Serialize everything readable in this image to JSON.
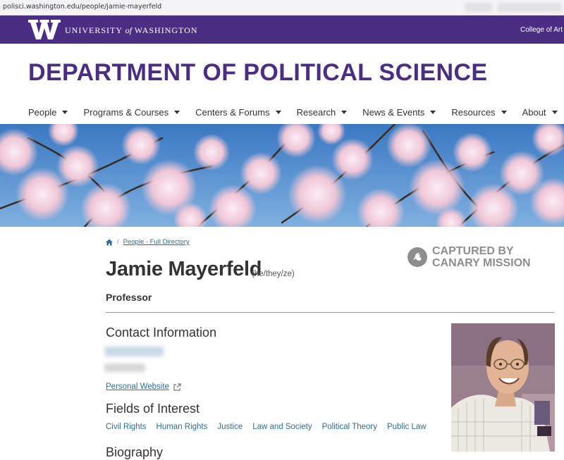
{
  "browser": {
    "url": "polisci.washington.edu/people/jamie-mayerfeld"
  },
  "uw_bar": {
    "university_name_pre": "UNIVERSITY",
    "university_name_of": "of",
    "university_name_post": "WASHINGTON",
    "college_link": "College of Art"
  },
  "header": {
    "department_title": "DEPARTMENT OF POLITICAL SCIENCE"
  },
  "nav": {
    "items": [
      {
        "label": "People"
      },
      {
        "label": "Programs & Courses"
      },
      {
        "label": "Centers & Forums"
      },
      {
        "label": "Research"
      },
      {
        "label": "News & Events"
      },
      {
        "label": "Resources"
      },
      {
        "label": "About"
      }
    ]
  },
  "breadcrumb": {
    "separator": "/",
    "link": "People - Full Directory"
  },
  "overlay": {
    "line1": "CAPTURED BY",
    "line2": "CANARY MISSION"
  },
  "profile": {
    "name": "Jamie Mayerfeld",
    "pronouns": "(he/they/ze)",
    "title": "Professor"
  },
  "contact": {
    "heading": "Contact Information",
    "website_label": "Personal Website"
  },
  "fields_of_interest": {
    "heading": "Fields of Interest",
    "items": [
      "Civil Rights",
      "Human Rights",
      "Justice",
      "Law and Society",
      "Political Theory",
      "Public Law"
    ]
  },
  "biography": {
    "heading": "Biography"
  },
  "icons": {
    "home": "home-icon",
    "external": "external-link-icon",
    "canary": "canary-bird-icon",
    "caret": "caret-down-icon"
  },
  "colors": {
    "uw_purple": "#4b2e83",
    "link_blue": "#2a6f97",
    "canary_gray": "#8d8d8d"
  }
}
